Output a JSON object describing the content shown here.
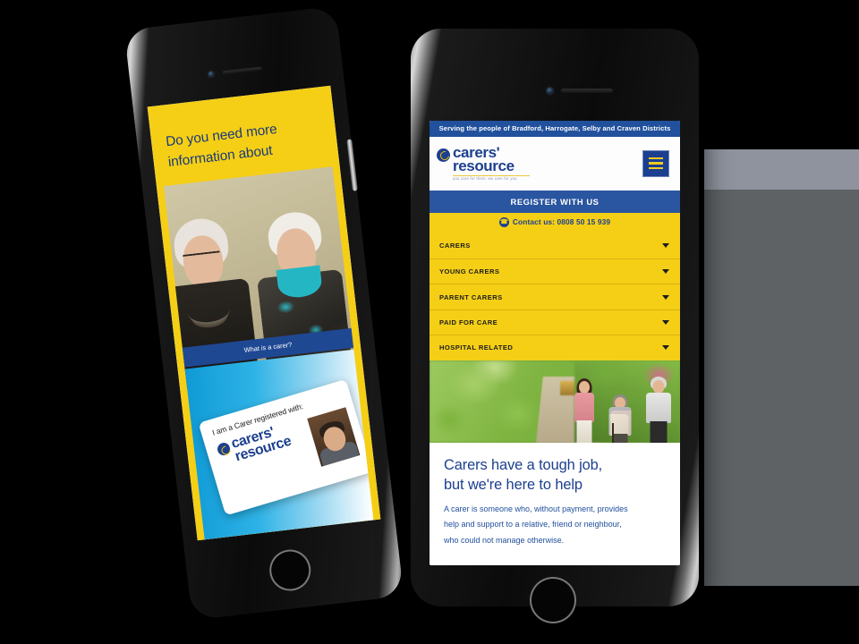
{
  "scene": {
    "title": "Carers' Resource mobile website mockup on two iPhones",
    "background_color": "#000000",
    "placeholder_blocks": [
      {
        "name": "light-grey-band",
        "color": "#8e939e"
      },
      {
        "name": "dark-grey-block",
        "color": "#5e6265"
      }
    ]
  },
  "brand": {
    "accent_blue": "#1c3f8f",
    "accent_yellow": "#f5cf16",
    "logo_line1": "carers'",
    "logo_line2": "resource",
    "logo_tagline": "you care for them, we care for you"
  },
  "right_phone": {
    "device_name": "iPhone",
    "site": {
      "top_strip": "Serving the people of Bradford, Harrogate, Selby and Craven Districts",
      "menu_icon": "hamburger-icon",
      "register_label": "REGISTER WITH US",
      "contact": {
        "icon": "phone-icon",
        "label": "Contact us:",
        "number": "0808 50 15 939",
        "full": "Contact us: 0808 50 15 939"
      },
      "accordion": [
        {
          "label": "CARERS",
          "caret": "chevron-down-icon"
        },
        {
          "label": "YOUNG CARERS",
          "caret": "chevron-down-icon"
        },
        {
          "label": "PARENT CARERS",
          "caret": "chevron-down-icon"
        },
        {
          "label": "PAID FOR CARE",
          "caret": "chevron-down-icon"
        },
        {
          "label": "HOSPITAL RELATED",
          "caret": "chevron-down-icon"
        }
      ],
      "hero_image_alt": "Young woman walking along a green garden path with two older people, one using a walking stick",
      "heading_line1": "Carers have a tough job,",
      "heading_line2": "but we're here to help",
      "body_line1": "A carer is someone who, without payment, provides",
      "body_line2": "help and support to a relative, friend or neighbour,",
      "body_line3": "who could not manage otherwise."
    }
  },
  "left_phone": {
    "device_name": "iPhone",
    "site": {
      "heading_line1": "Do you need more",
      "heading_line2": "information about",
      "photo_alt": "Two older women sitting close together and talking, one wearing glasses",
      "button_label": "What is a carer?",
      "card": {
        "caption": "I am a Carer registered with:",
        "logo_line1": "carers'",
        "logo_line2": "resource",
        "photo_alt": "Portrait photo of a carer wearing glasses"
      }
    }
  }
}
